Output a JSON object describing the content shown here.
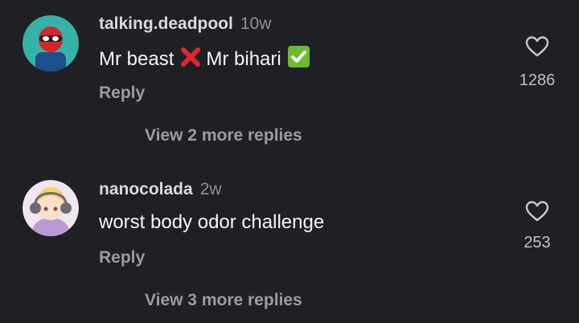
{
  "comments": [
    {
      "username": "talking.deadpool",
      "time": "10w",
      "text_before": "Mr beast",
      "emoji_1": "cross-mark-emoji",
      "text_middle": "Mr bihari",
      "emoji_2": "check-mark-emoji",
      "reply_label": "Reply",
      "like_count": "1286",
      "view_more": "View 2 more replies",
      "avatar": "deadpool-avatar"
    },
    {
      "username": "nanocolada",
      "time": "2w",
      "text": "worst body odor challenge",
      "reply_label": "Reply",
      "like_count": "253",
      "view_more": "View 3 more replies",
      "avatar": "anime-girl-avatar"
    }
  ],
  "colors": {
    "background": "#1f2024",
    "username": "#d9dadd",
    "secondary": "#9a9ca1",
    "text": "#f5f5f5"
  }
}
